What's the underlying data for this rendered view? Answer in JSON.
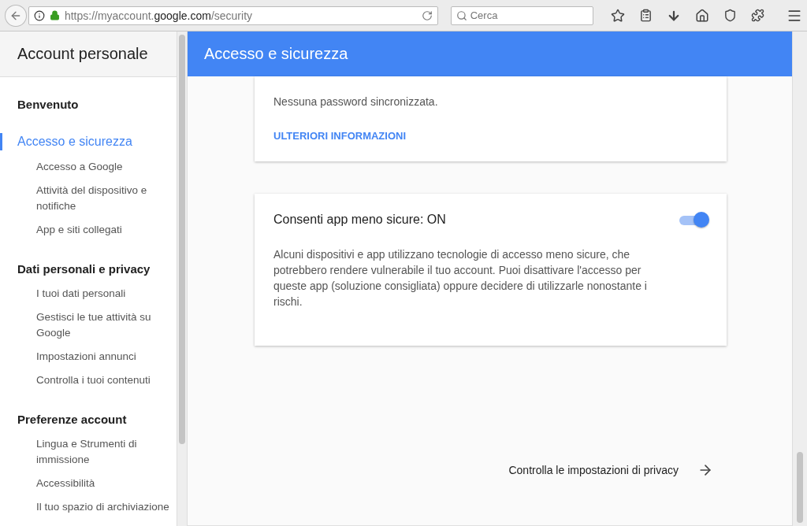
{
  "browser": {
    "url": "https://myaccount.**google.com**/security",
    "search": {
      "placeholder": "Cerca"
    }
  },
  "sidebar": {
    "title": "Account personale",
    "sections": [
      {
        "label": "Benvenuto",
        "selected": false
      },
      {
        "label": "Accesso e sicurezza",
        "selected": true,
        "items": [
          "Accesso a Google",
          "Attività del dispositivo e notifiche",
          "App e siti collegati"
        ]
      },
      {
        "label": "Dati personali e privacy",
        "selected": false,
        "items": [
          "I tuoi dati personali",
          "Gestisci le tue attività su Google",
          "Impostazioni annunci",
          "Controlla i tuoi contenuti"
        ]
      },
      {
        "label": "Preferenze account",
        "selected": false,
        "items": [
          "Lingua e Strumenti di immissione",
          "Accessibilità",
          "Il tuo spazio di archiviazione"
        ]
      }
    ]
  },
  "header": {
    "title": "Accesso e sicurezza"
  },
  "password_card": {
    "text": "Nessuna password sincronizzata.",
    "link": "ULTERIORI INFORMAZIONI"
  },
  "less_secure_card": {
    "title": "Consenti app meno sicure: ON",
    "on": true,
    "description": "Alcuni dispositivi e app utilizzano tecnologie di accesso meno sicure, che potrebbero rendere vulnerabile il tuo account. Puoi disattivare l'accesso per queste app (soluzione consigliata) oppure decidere di utilizzarle nonostante i rischi."
  },
  "footer_link": {
    "label": "Controlla le impostazioni di privacy"
  }
}
